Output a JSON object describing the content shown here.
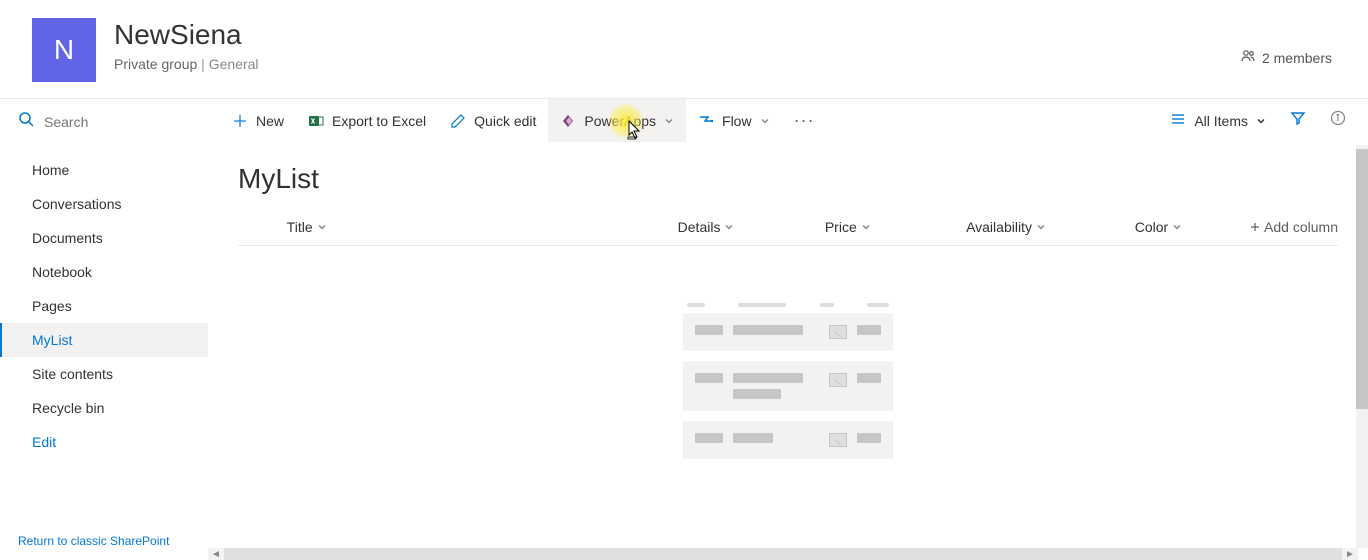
{
  "site": {
    "logo_letter": "N",
    "title": "NewSiena",
    "group_type": "Private group",
    "classification": "General",
    "members_label": "2 members"
  },
  "search": {
    "placeholder": "Search"
  },
  "nav": {
    "items": [
      {
        "label": "Home",
        "selected": false
      },
      {
        "label": "Conversations",
        "selected": false
      },
      {
        "label": "Documents",
        "selected": false
      },
      {
        "label": "Notebook",
        "selected": false
      },
      {
        "label": "Pages",
        "selected": false
      },
      {
        "label": "MyList",
        "selected": true
      },
      {
        "label": "Site contents",
        "selected": false
      },
      {
        "label": "Recycle bin",
        "selected": false
      }
    ],
    "edit_label": "Edit",
    "classic_link_label": "Return to classic SharePoint"
  },
  "command_bar": {
    "new_label": "New",
    "export_label": "Export to Excel",
    "quick_edit_label": "Quick edit",
    "powerapps_label": "PowerApps",
    "flow_label": "Flow",
    "view_label": "All Items"
  },
  "list": {
    "title": "MyList",
    "columns": {
      "title": "Title",
      "details": "Details",
      "price": "Price",
      "availability": "Availability",
      "color": "Color",
      "add_label": "Add column"
    }
  }
}
